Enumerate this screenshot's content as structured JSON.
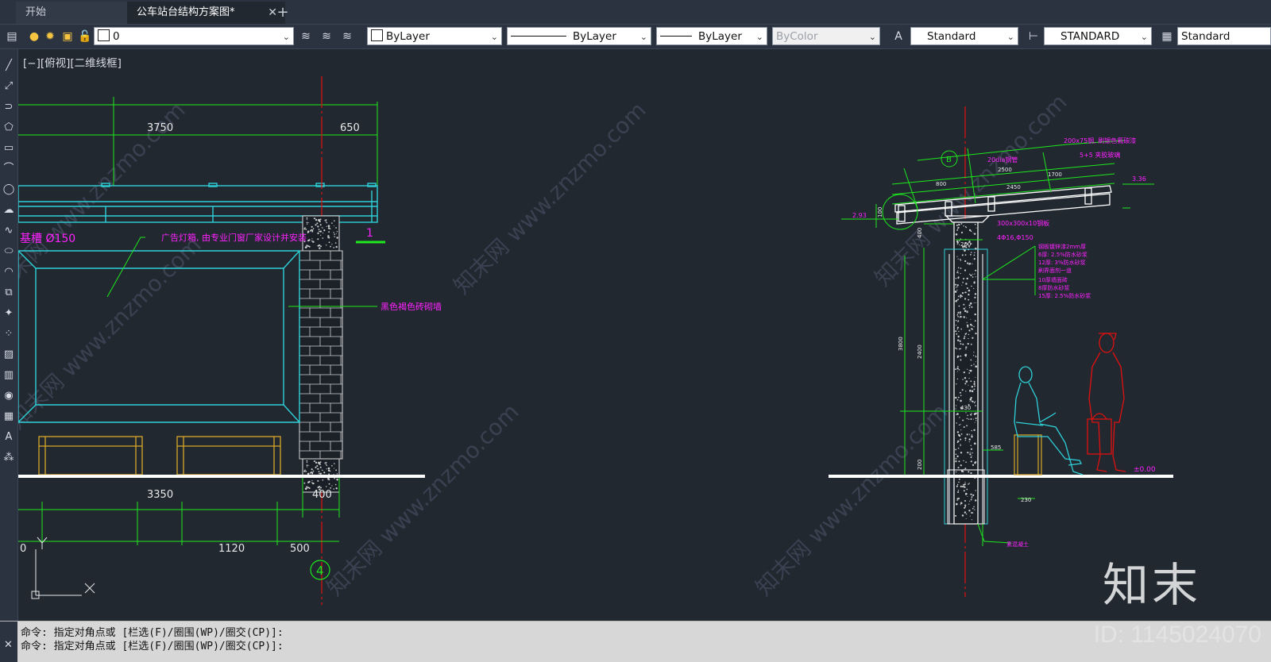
{
  "tabs": {
    "start": "开始",
    "drawing": "公车站台结构方案图*",
    "close": "✕",
    "add": "+"
  },
  "toolbar": {
    "layer": "0",
    "color": "ByLayer",
    "linetype": "ByLayer",
    "lineweight": "ByLayer",
    "plotstyle": "ByColor",
    "textstyle": "Standard",
    "dimstyle": "STANDARD",
    "tablestyle": "Standard"
  },
  "viewport": {
    "label": "[−][俯视][二维线框]"
  },
  "drawing_left": {
    "dim_top_1": "3750",
    "dim_top_2": "650",
    "dim_bottom_1": "3350",
    "dim_bottom_2": "400",
    "dim_bottom_3": "1120",
    "dim_bottom_4": "500",
    "dim_bottom_0": "0",
    "pipe_label": "基槽 Ø150",
    "ad_note": "广告灯箱, 由专业门窗厂家设计并安装",
    "brick_note": "黑色褐色砖砌墙",
    "axis_mark": "1",
    "axis_circle": "4"
  },
  "drawing_right": {
    "top_note_1": "200x75钢, 刷银色氟碳漆",
    "top_note_2": "5+5 夹胶玻璃",
    "top_note_3": "20dia钢管",
    "dim_2500": "2500",
    "dim_1700": "1700",
    "dim_800": "800",
    "dim_2450": "2450",
    "elev_top": "3.36",
    "elev_left": "2.93",
    "dim_100": "100",
    "dim_400": "400",
    "dim_200": "200",
    "note_plate": "300x300x10钢板",
    "note_rebar": "4Φ16,Φ150",
    "layer_notes": [
      "钢板镀锌漆2mm厚",
      "6厚: 2.5%防水砂浆",
      "12厚: 3%防水砂浆",
      "刷界面剂一道",
      "10厚墙面砖",
      "8厚防水砂浆",
      "15厚: 2.5%防水砂浆"
    ],
    "dim_3800": "3800",
    "dim_2400": "2400",
    "dim_200b": "200",
    "dim_430": "430",
    "dim_585": "585",
    "dim_230": "230",
    "elev_ground": "±0.00",
    "axis_circle": "B",
    "bottom_note": "素混凝土"
  },
  "command": {
    "line1": "命令: 指定对角点或 [栏选(F)/圈围(WP)/圈交(CP)]:",
    "line2": "命令: 指定对角点或 [栏选(F)/圈围(WP)/圈交(CP)]:"
  },
  "watermark": {
    "logo": "知末",
    "id": "ID: 1145024070",
    "site": "知末网 www.znzmo.com"
  },
  "colors": {
    "dim": "#1ee81e",
    "struct": "#2fd0d8",
    "axis": "#e01010",
    "note": "#ff22ff",
    "bench": "#d8a828",
    "ground": "#ffffff"
  }
}
